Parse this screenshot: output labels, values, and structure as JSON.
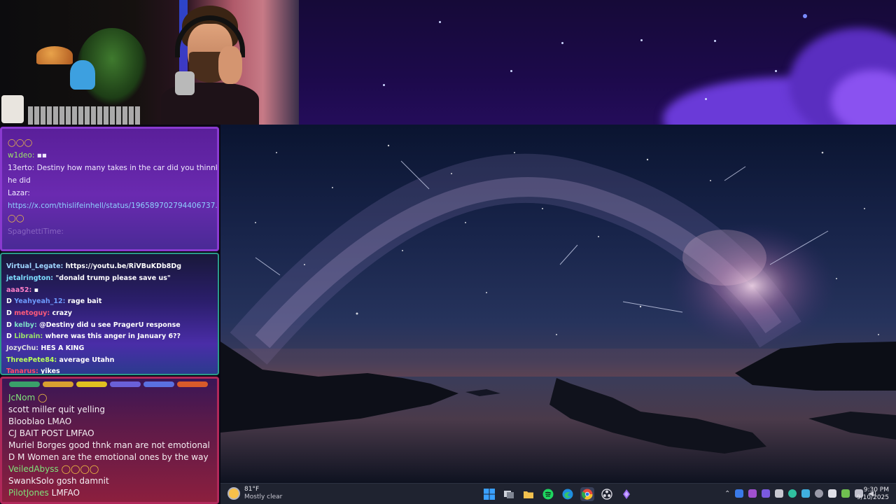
{
  "chat_top": {
    "lines": [
      {
        "name": "",
        "text": ""
      },
      {
        "name": "w1deo:",
        "text": ""
      },
      {
        "name": "13erto:",
        "text": "Destiny how many takes in the car did you thinnk"
      },
      {
        "name": "",
        "text": "he did"
      },
      {
        "name": "Lazar:",
        "text": ""
      },
      {
        "name": "",
        "text": "https://x.com/thislifeinhell/status/196589702794406737..."
      },
      {
        "name": "SpaghettiTime:",
        "text": ""
      }
    ]
  },
  "chat_mid": {
    "lines": [
      {
        "name": "Virtual_Legate:",
        "text": "https://youtu.be/RiVBuKDb8Dg",
        "color": "#9fd6ff"
      },
      {
        "name": "jetalrington:",
        "text": "\"donald trump please save us\"",
        "color": "#7ee0ff"
      },
      {
        "name": "aaa52:",
        "text": "",
        "color": "#ff7fc8"
      },
      {
        "name": "Yeahyeah_12:",
        "text": "rage bait",
        "color": "#6f9cff"
      },
      {
        "name": "metoguy:",
        "text": "crazy",
        "color": "#ff5a7a"
      },
      {
        "name": "kelby:",
        "text": "@Destiny did u see PragerU response",
        "color": "#7ee0c8"
      },
      {
        "name": "Librain:",
        "text": "where was this anger in January 6??",
        "color": "#9be36a"
      },
      {
        "name": "JozyChu:",
        "text": "HES A KING",
        "color": "#e0e0e0"
      },
      {
        "name": "ThreePete84:",
        "text": "average Utahn",
        "color": "#b8ff5a"
      },
      {
        "name": "Tanarus:",
        "text": "yikes",
        "color": "#ff4a6a"
      }
    ]
  },
  "chat_bottom": {
    "lines": [
      {
        "name": "JcNom",
        "text": "",
        "color": "#7fe37a"
      },
      {
        "name": "",
        "text": "scott miller quit yelling",
        "color": "#f4eef2"
      },
      {
        "name": "",
        "text": "Blooblao LMAO",
        "color": "#f4eef2"
      },
      {
        "name": "",
        "text": "CJ BAIT POST LMFAO",
        "color": "#f4eef2"
      },
      {
        "name": "",
        "text": "Muriel Borges good thnk man are not emotional",
        "color": "#f4eef2"
      },
      {
        "name": "",
        "text": "D M Women are the emotional ones by the way",
        "color": "#f4eef2"
      },
      {
        "name": "VeiledAbyss",
        "text": "",
        "color": "#7fe37a"
      },
      {
        "name": "",
        "text": "SwankSolo gosh damnit",
        "color": "#f4eef2"
      },
      {
        "name": "PilotJones",
        "text": "LMFAO",
        "color": "#7fe37a"
      }
    ]
  },
  "taskbar": {
    "weather_temp": "81°F",
    "weather_desc": "Mostly clear",
    "time": "9:30 PM",
    "date": "9/10/2025",
    "pinned": [
      "start-icon",
      "task-view-icon",
      "file-explorer-icon",
      "spotify-icon",
      "edge-icon",
      "chrome-icon",
      "obs-icon",
      "streaming-app-icon"
    ]
  }
}
